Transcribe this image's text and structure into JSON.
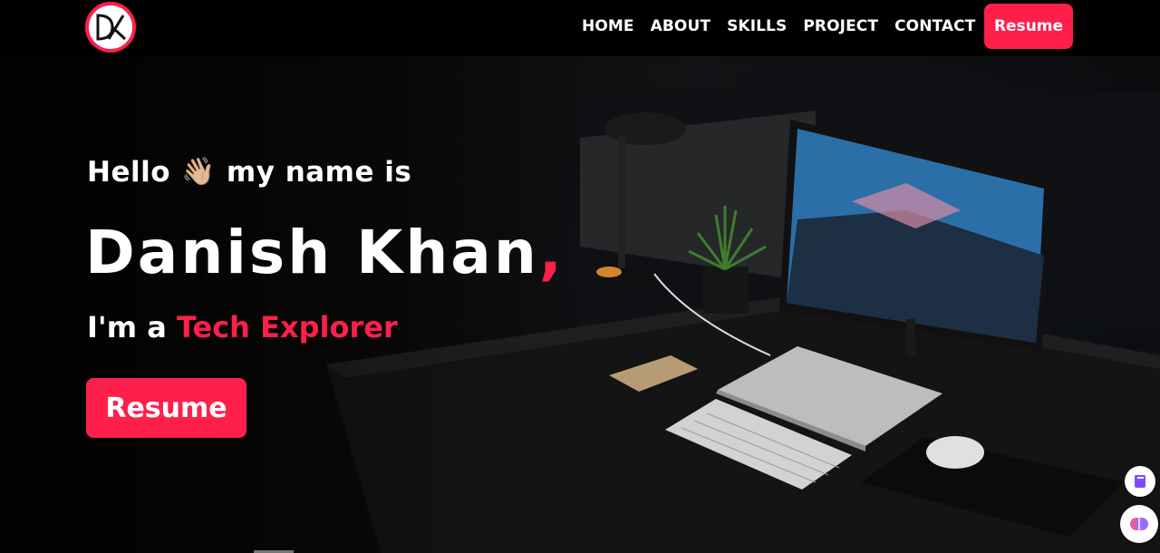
{
  "nav": {
    "logo_icon": "dk-monogram-logo",
    "links": [
      "HOME",
      "ABOUT",
      "SKILLS",
      "PROJECT",
      "CONTACT"
    ],
    "resume_label": "Resume"
  },
  "hero": {
    "greeting_before": "Hello",
    "greeting_emoji": "👋🏼",
    "greeting_after": "my name is",
    "name": "Danish Khan",
    "name_suffix": ",",
    "tagline_prefix": "I'm a",
    "tagline_accent": "Tech Explorer",
    "resume_label": "Resume",
    "background": "dark desk setup with monitor, laptop, keyboard, lamp and plant"
  },
  "widgets": {
    "book_icon": "book-icon",
    "brain_icon": "brain-icon"
  },
  "colors": {
    "accent": "#ff1f4b",
    "background": "#000000",
    "text": "#ffffff"
  }
}
